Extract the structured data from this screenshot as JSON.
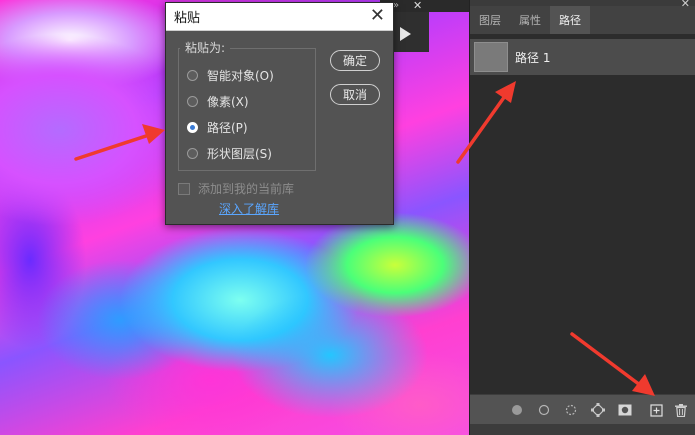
{
  "canvas": {
    "strip_expand": "»",
    "strip_close": "✕",
    "play_icon": "play-icon"
  },
  "dialog": {
    "title": "粘贴",
    "close": "✕",
    "group_label": "粘贴为:",
    "options": [
      {
        "label": "智能对象(O)",
        "checked": false
      },
      {
        "label": "像素(X)",
        "checked": false
      },
      {
        "label": "路径(P)",
        "checked": true
      },
      {
        "label": "形状图层(S)",
        "checked": false
      }
    ],
    "ok_label": "确定",
    "cancel_label": "取消",
    "add_to_library": "添加到我的当前库",
    "learn_link": "深入了解库"
  },
  "panel": {
    "close": "✕",
    "tabs": [
      {
        "label": "图层",
        "active": false
      },
      {
        "label": "属性",
        "active": false
      },
      {
        "label": "路径",
        "active": true
      }
    ],
    "paths": [
      {
        "name": "路径 1"
      }
    ],
    "footer_icons": [
      "fill-path-icon",
      "stroke-path-icon",
      "load-selection-icon",
      "make-work-path-icon",
      "add-mask-icon",
      "new-path-icon",
      "delete-path-icon"
    ]
  },
  "colors": {
    "annotation_arrow": "#f03a2e",
    "link": "#5aa6ff"
  }
}
